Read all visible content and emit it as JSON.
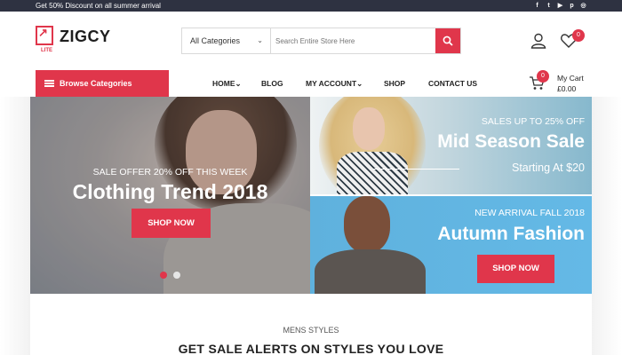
{
  "topbar": {
    "promo_text": "Get 50% Discount on all summer arrival",
    "social_icons": [
      "facebook-icon",
      "twitter-icon",
      "youtube-icon",
      "pinterest-icon",
      "instagram-icon"
    ]
  },
  "brand": {
    "name": "ZIGCY",
    "sub": "LITE",
    "accent_color": "#e0364b"
  },
  "search": {
    "category_value": "All Categories",
    "placeholder": "Search Entire Store Here"
  },
  "header": {
    "wishlist_count": "0",
    "cart_count": "0"
  },
  "nav": {
    "browse_label": "Browse Categories",
    "items": [
      {
        "label": "HOME",
        "has_dropdown": true
      },
      {
        "label": "BLOG",
        "has_dropdown": false
      },
      {
        "label": "MY ACCOUNT",
        "has_dropdown": true
      },
      {
        "label": "SHOP",
        "has_dropdown": false
      },
      {
        "label": "CONTACT US",
        "has_dropdown": false
      }
    ],
    "cart_label": "My Cart",
    "cart_total": "£0.00"
  },
  "hero": {
    "main": {
      "kicker": "SALE OFFER 20% OFF THIS WEEK",
      "title": "Clothing Trend 2018",
      "button": "SHOP NOW"
    },
    "top_right": {
      "kicker": "SALES UP TO 25% OFF",
      "title": "Mid Season Sale",
      "subtitle": "Starting At $20"
    },
    "bottom_right": {
      "kicker": "NEW ARRIVAL FALL 2018",
      "title": "Autumn Fashion",
      "button": "SHOP NOW"
    },
    "slider_dots": 2,
    "active_dot": 0
  },
  "section": {
    "kicker": "MENS STYLES",
    "heading": "GET SALE ALERTS ON STYLES YOU LOVE"
  }
}
